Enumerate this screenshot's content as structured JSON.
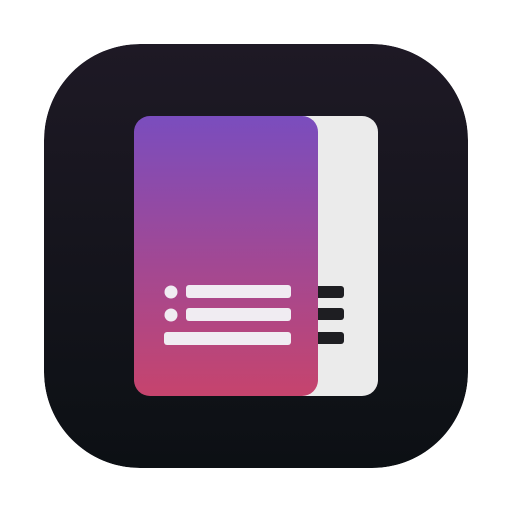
{
  "app_icon": {
    "icon": "document-stack-list-icon",
    "colors": {
      "background_top": "#1E1925",
      "background_bottom": "#0C1014",
      "front_card_top": "#7A4DBE",
      "front_card_bottom": "#C6446D",
      "back_card": "#EBEBEB",
      "front_card_lines": "#F0ECF2",
      "back_card_lines": "#1E1E22"
    }
  }
}
